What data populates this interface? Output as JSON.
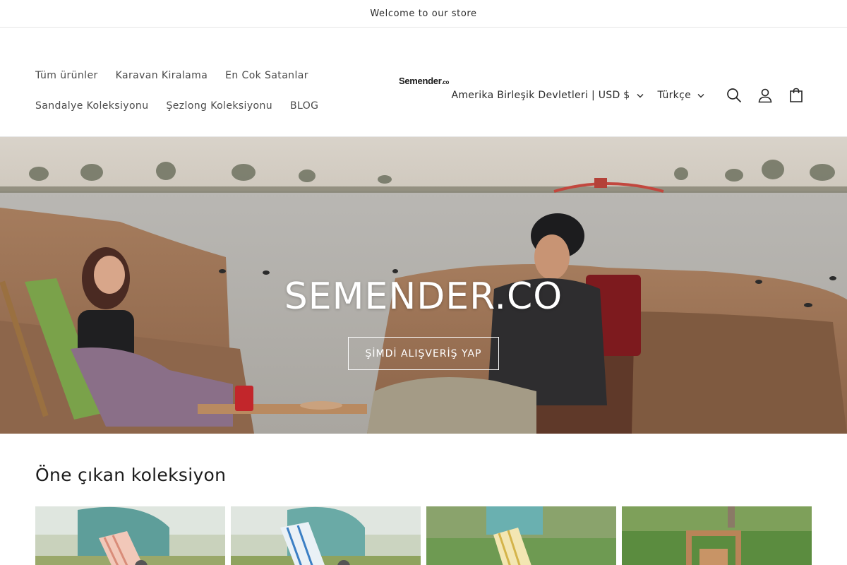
{
  "announcement": {
    "text": "Welcome to our store"
  },
  "nav": {
    "row1": [
      "Tüm ürünler",
      "Karavan Kiralama",
      "En Cok Satanlar"
    ],
    "row2": [
      "Sandalye Koleksiyonu",
      "Şezlong Koleksiyonu",
      "BLOG"
    ]
  },
  "logo": {
    "name": "Semender",
    "suffix": ".co"
  },
  "header": {
    "country_selector": "Amerika Birleşik Devletleri | USD $",
    "language_selector": "Türkçe"
  },
  "icons": [
    "search-icon",
    "account-icon",
    "cart-icon",
    "chevron-down-icon"
  ],
  "hero": {
    "title": "SEMENDER.CO",
    "button": "ŞİMDİ ALIŞVERİŞ YAP"
  },
  "featured": {
    "heading": "Öne çıkan koleksiyon"
  }
}
